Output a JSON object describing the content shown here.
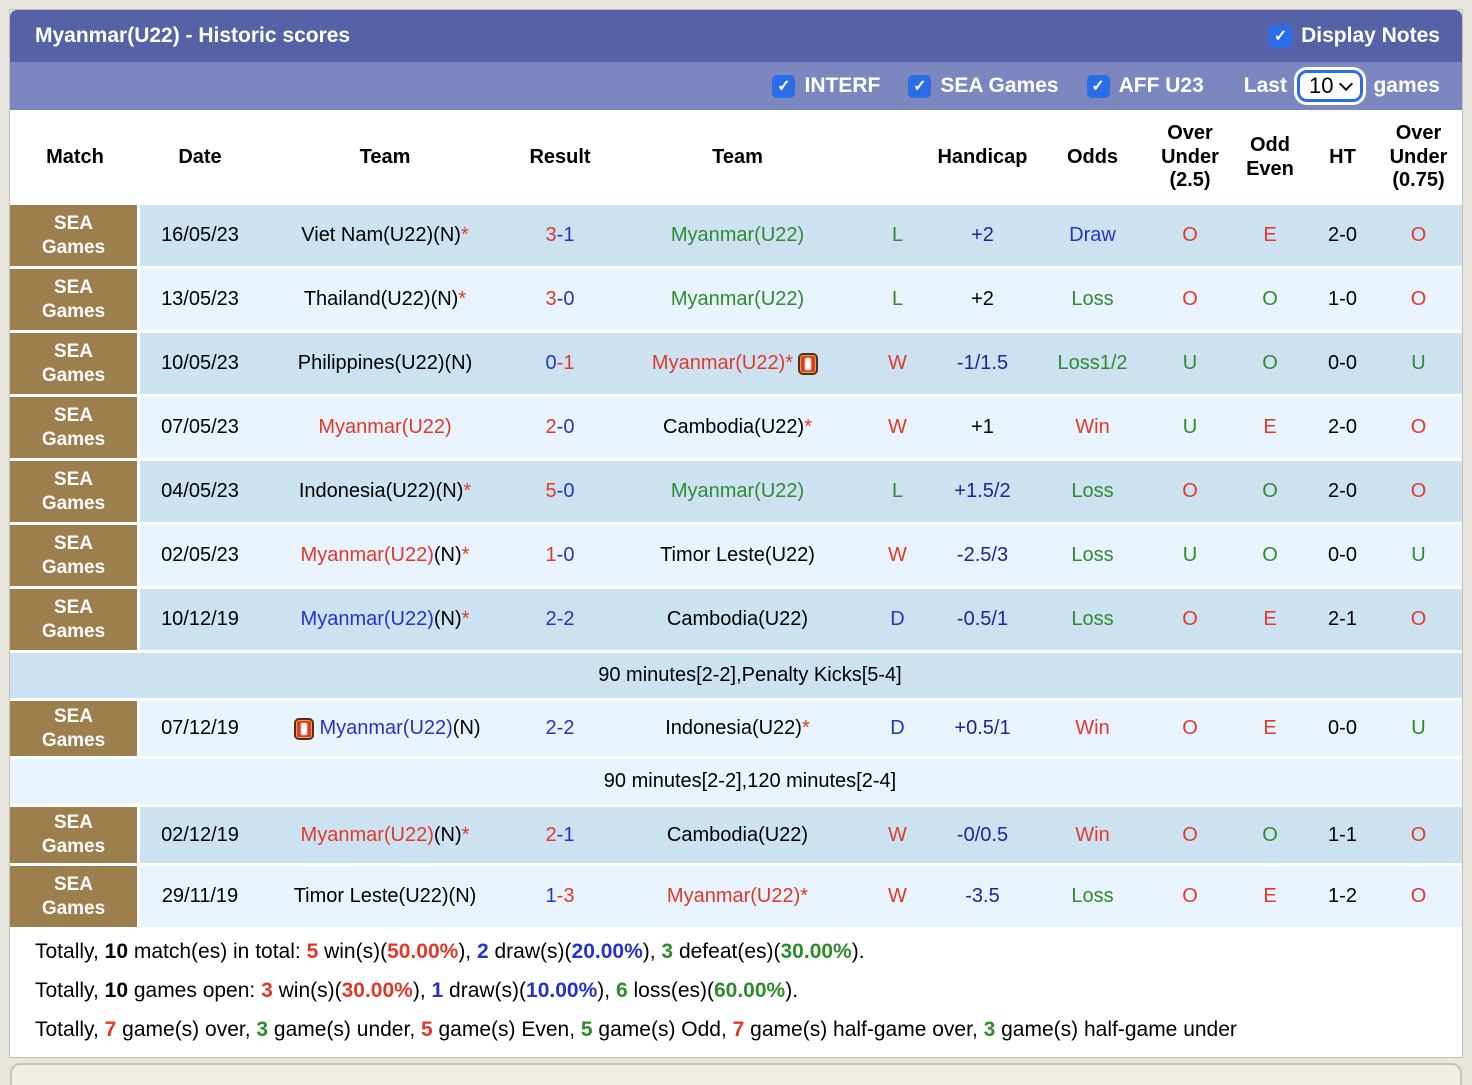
{
  "title_bar": {
    "title": "Myanmar(U22) - Historic scores",
    "display_notes_label": "Display Notes",
    "display_notes_checked": true
  },
  "filter_bar": {
    "checkboxes": [
      {
        "label": "INTERF",
        "checked": true
      },
      {
        "label": "SEA Games",
        "checked": true
      },
      {
        "label": "AFF U23",
        "checked": true
      }
    ],
    "last_label": "Last",
    "games_count": "10",
    "games_label": "games"
  },
  "colors": {
    "red": "#e0392a",
    "blue": "#2434c8",
    "navy": "#1c249c",
    "green": "#2e8b2e",
    "black": "#000000",
    "title_bar": "#5662a6",
    "filter_bar": "#7d87bf",
    "checkbox_blue": "#2b6de8",
    "row_dark": "#cde2f1",
    "row_light": "#e9f3fb",
    "match_cell_brown": "#9d7e4d"
  },
  "table": {
    "headers": [
      "Match",
      "Date",
      "Team",
      "Result",
      "Team",
      "",
      "Handicap",
      "Odds",
      "Over Under (2.5)",
      "Odd Even",
      "HT",
      "Over Under (0.75)"
    ],
    "rows": [
      {
        "match": "SEA Games",
        "date": "16/05/23",
        "team1": [
          [
            "Viet Nam(U22)(N)",
            "k"
          ],
          [
            "*",
            "r"
          ]
        ],
        "result": [
          [
            "3",
            "r"
          ],
          [
            "-1",
            "b"
          ]
        ],
        "team2": [
          [
            "Myanmar(U22)",
            "g"
          ]
        ],
        "letter": [
          "L",
          "g"
        ],
        "handicap": [
          "+2",
          "n"
        ],
        "odds": [
          "Draw",
          "b"
        ],
        "over_under_25": [
          "O",
          "r"
        ],
        "odd_even": [
          "E",
          "r"
        ],
        "ht": "2-0",
        "over_under_075": [
          "O",
          "r"
        ]
      },
      {
        "match": "SEA Games",
        "date": "13/05/23",
        "team1": [
          [
            "Thailand(U22)(N)",
            "k"
          ],
          [
            "*",
            "r"
          ]
        ],
        "result": [
          [
            "3",
            "r"
          ],
          [
            "-0",
            "b"
          ]
        ],
        "team2": [
          [
            "Myanmar(U22)",
            "g"
          ]
        ],
        "letter": [
          "L",
          "g"
        ],
        "handicap": [
          "+2",
          "k"
        ],
        "odds": [
          "Loss",
          "g"
        ],
        "over_under_25": [
          "O",
          "r"
        ],
        "odd_even": [
          "O",
          "g"
        ],
        "ht": "1-0",
        "over_under_075": [
          "O",
          "r"
        ]
      },
      {
        "match": "SEA Games",
        "date": "10/05/23",
        "team1": [
          [
            "Philippines(U22)(N)",
            "k"
          ]
        ],
        "result": [
          [
            "0",
            "b"
          ],
          [
            "-1",
            "r"
          ]
        ],
        "team2": [
          [
            "Myanmar(U22)*",
            "r"
          ]
        ],
        "team2_badge": "end",
        "letter": [
          "W",
          "r"
        ],
        "handicap": [
          "-1/1.5",
          "n"
        ],
        "odds": [
          "Loss1/2",
          "g"
        ],
        "over_under_25": [
          "U",
          "g"
        ],
        "odd_even": [
          "O",
          "g"
        ],
        "ht": "0-0",
        "over_under_075": [
          "U",
          "g"
        ]
      },
      {
        "match": "SEA Games",
        "date": "07/05/23",
        "team1": [
          [
            "Myanmar(U22)",
            "r"
          ]
        ],
        "result": [
          [
            "2",
            "r"
          ],
          [
            "-0",
            "b"
          ]
        ],
        "team2": [
          [
            "Cambodia(U22)",
            "k"
          ],
          [
            "*",
            "r"
          ]
        ],
        "letter": [
          "W",
          "r"
        ],
        "handicap": [
          "+1",
          "k"
        ],
        "odds": [
          "Win",
          "r"
        ],
        "over_under_25": [
          "U",
          "g"
        ],
        "odd_even": [
          "E",
          "r"
        ],
        "ht": "2-0",
        "over_under_075": [
          "O",
          "r"
        ]
      },
      {
        "match": "SEA Games",
        "date": "04/05/23",
        "team1": [
          [
            "Indonesia(U22)(N)",
            "k"
          ],
          [
            "*",
            "r"
          ]
        ],
        "result": [
          [
            "5",
            "r"
          ],
          [
            "-0",
            "b"
          ]
        ],
        "team2": [
          [
            "Myanmar(U22)",
            "g"
          ]
        ],
        "letter": [
          "L",
          "g"
        ],
        "handicap": [
          "+1.5/2",
          "n"
        ],
        "odds": [
          "Loss",
          "g"
        ],
        "over_under_25": [
          "O",
          "r"
        ],
        "odd_even": [
          "O",
          "g"
        ],
        "ht": "2-0",
        "over_under_075": [
          "O",
          "r"
        ]
      },
      {
        "match": "SEA Games",
        "date": "02/05/23",
        "team1": [
          [
            "Myanmar(U22)",
            "r"
          ],
          [
            "(N)",
            "k"
          ],
          [
            "*",
            "r"
          ]
        ],
        "result": [
          [
            "1",
            "r"
          ],
          [
            "-0",
            "b"
          ]
        ],
        "team2": [
          [
            "Timor Leste(U22)",
            "k"
          ]
        ],
        "letter": [
          "W",
          "r"
        ],
        "handicap": [
          "-2.5/3",
          "n"
        ],
        "odds": [
          "Loss",
          "g"
        ],
        "over_under_25": [
          "U",
          "g"
        ],
        "odd_even": [
          "O",
          "g"
        ],
        "ht": "0-0",
        "over_under_075": [
          "U",
          "g"
        ]
      },
      {
        "match": "SEA Games",
        "date": "10/12/19",
        "team1": [
          [
            "Myanmar(U22)",
            "b"
          ],
          [
            "(N)",
            "k"
          ],
          [
            "*",
            "r"
          ]
        ],
        "result": [
          [
            "2",
            "b"
          ],
          [
            "-2",
            "b"
          ]
        ],
        "team2": [
          [
            "Cambodia(U22)",
            "k"
          ]
        ],
        "letter": [
          "D",
          "b"
        ],
        "handicap": [
          "-0.5/1",
          "n"
        ],
        "odds": [
          "Loss",
          "g"
        ],
        "over_under_25": [
          "O",
          "r"
        ],
        "odd_even": [
          "E",
          "r"
        ],
        "ht": "2-1",
        "over_under_075": [
          "O",
          "r"
        ],
        "note": "90 minutes[2-2],Penalty Kicks[5-4]"
      },
      {
        "match": "SEA Games",
        "date": "07/12/19",
        "team1": [
          [
            "Myanmar(U22)",
            "b"
          ],
          [
            "(N)",
            "k"
          ]
        ],
        "team1_badge": "start",
        "result": [
          [
            "2",
            "b"
          ],
          [
            "-2",
            "b"
          ]
        ],
        "team2": [
          [
            "Indonesia(U22)",
            "k"
          ],
          [
            "*",
            "r"
          ]
        ],
        "letter": [
          "D",
          "b"
        ],
        "handicap": [
          "+0.5/1",
          "n"
        ],
        "odds": [
          "Win",
          "r"
        ],
        "over_under_25": [
          "O",
          "r"
        ],
        "odd_even": [
          "E",
          "r"
        ],
        "ht": "0-0",
        "over_under_075": [
          "U",
          "g"
        ],
        "note": "90 minutes[2-2],120 minutes[2-4]"
      },
      {
        "match": "SEA Games",
        "date": "02/12/19",
        "team1": [
          [
            "Myanmar(U22)",
            "r"
          ],
          [
            "(N)",
            "k"
          ],
          [
            "*",
            "r"
          ]
        ],
        "result": [
          [
            "2",
            "r"
          ],
          [
            "-1",
            "b"
          ]
        ],
        "team2": [
          [
            "Cambodia(U22)",
            "k"
          ]
        ],
        "letter": [
          "W",
          "r"
        ],
        "handicap": [
          "-0/0.5",
          "n"
        ],
        "odds": [
          "Win",
          "r"
        ],
        "over_under_25": [
          "O",
          "r"
        ],
        "odd_even": [
          "O",
          "g"
        ],
        "ht": "1-1",
        "over_under_075": [
          "O",
          "r"
        ]
      },
      {
        "match": "SEA Games",
        "date": "29/11/19",
        "team1": [
          [
            "Timor Leste(U22)(N)",
            "k"
          ]
        ],
        "result": [
          [
            "1",
            "b"
          ],
          [
            "-3",
            "r"
          ]
        ],
        "team2": [
          [
            "Myanmar(U22)*",
            "r"
          ]
        ],
        "letter": [
          "W",
          "r"
        ],
        "handicap": [
          "-3.5",
          "n"
        ],
        "odds": [
          "Loss",
          "g"
        ],
        "over_under_25": [
          "O",
          "r"
        ],
        "odd_even": [
          "E",
          "r"
        ],
        "ht": "1-2",
        "over_under_075": [
          "O",
          "r"
        ]
      }
    ]
  },
  "summary": {
    "lines": [
      [
        [
          "Totally, ",
          "k",
          0
        ],
        [
          "10",
          "k",
          1
        ],
        [
          " match(es) in total: ",
          "k",
          0
        ],
        [
          "5",
          "r",
          1
        ],
        [
          " win(s)(",
          "k",
          0
        ],
        [
          "50.00%",
          "r",
          1
        ],
        [
          "), ",
          "k",
          0
        ],
        [
          "2",
          "b",
          1
        ],
        [
          " draw(s)(",
          "k",
          0
        ],
        [
          "20.00%",
          "b",
          1
        ],
        [
          "), ",
          "k",
          0
        ],
        [
          "3",
          "g",
          1
        ],
        [
          " defeat(es)(",
          "k",
          0
        ],
        [
          "30.00%",
          "g",
          1
        ],
        [
          ").",
          "k",
          0
        ]
      ],
      [
        [
          "Totally, ",
          "k",
          0
        ],
        [
          "10",
          "k",
          1
        ],
        [
          " games open: ",
          "k",
          0
        ],
        [
          "3",
          "r",
          1
        ],
        [
          " win(s)(",
          "k",
          0
        ],
        [
          "30.00%",
          "r",
          1
        ],
        [
          "), ",
          "k",
          0
        ],
        [
          "1",
          "b",
          1
        ],
        [
          " draw(s)(",
          "k",
          0
        ],
        [
          "10.00%",
          "b",
          1
        ],
        [
          "), ",
          "k",
          0
        ],
        [
          "6",
          "g",
          1
        ],
        [
          " loss(es)(",
          "k",
          0
        ],
        [
          "60.00%",
          "g",
          1
        ],
        [
          ").",
          "k",
          0
        ]
      ],
      [
        [
          "Totally, ",
          "k",
          0
        ],
        [
          "7",
          "r",
          1
        ],
        [
          " game(s) over, ",
          "k",
          0
        ],
        [
          "3",
          "g",
          1
        ],
        [
          " game(s) under, ",
          "k",
          0
        ],
        [
          "5",
          "r",
          1
        ],
        [
          " game(s) Even, ",
          "k",
          0
        ],
        [
          "5",
          "g",
          1
        ],
        [
          " game(s) Odd, ",
          "k",
          0
        ],
        [
          "7",
          "r",
          1
        ],
        [
          " game(s) half-game over, ",
          "k",
          0
        ],
        [
          "3",
          "g",
          1
        ],
        [
          " game(s) half-game under",
          "k",
          0
        ]
      ]
    ]
  }
}
